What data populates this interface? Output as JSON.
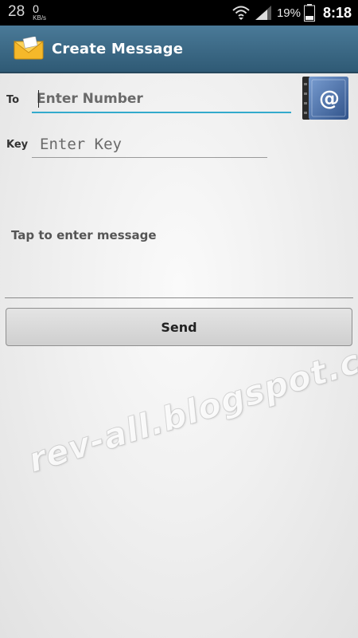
{
  "status_bar": {
    "temperature": "28",
    "net_speed_value": "0",
    "net_speed_unit": "KB/s",
    "battery_percent": "19%",
    "time": "8:18",
    "icons": [
      "wifi-icon",
      "signal-icon",
      "battery-icon"
    ]
  },
  "action_bar": {
    "title": "Create Message",
    "icon": "envelope-icon"
  },
  "form": {
    "to_label": "To",
    "number_placeholder": "Enter Number",
    "number_value": "",
    "key_label": "Key",
    "key_placeholder": "Enter Key",
    "key_value": "",
    "contacts_icon": "address-book-icon",
    "message_placeholder": "Tap to enter message",
    "message_value": "",
    "send_label": "Send"
  },
  "watermark": "rev-all.blogspot.com",
  "colors": {
    "action_bar": "#3c6a87",
    "focus_underline": "#33aacc",
    "address_book": "#4a6fa8"
  }
}
